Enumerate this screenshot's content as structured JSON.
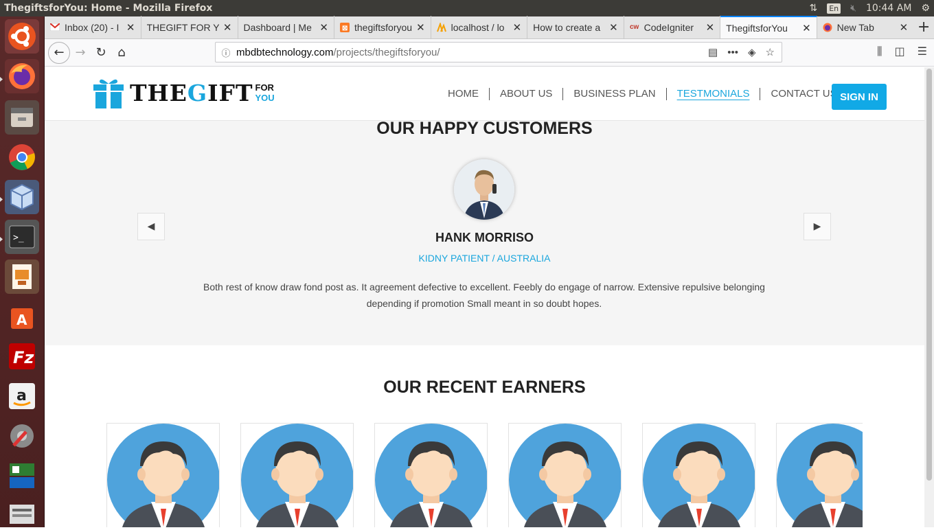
{
  "window": {
    "title": "ThegiftsforYou: Home - Mozilla Firefox",
    "time": "10:44 AM",
    "lang": "En"
  },
  "tabs": [
    {
      "label": "Inbox (20) - I",
      "icon": "gmail-icon",
      "color": "#d93025"
    },
    {
      "label": "THEGIFT FOR YOU",
      "icon": "",
      "color": ""
    },
    {
      "label": "Dashboard | Me",
      "icon": "",
      "color": ""
    },
    {
      "label": "thegiftsforyou",
      "icon": "xampp-icon",
      "color": "#fb7a24"
    },
    {
      "label": "localhost / lo",
      "icon": "phpmyadmin-icon",
      "color": "#f5a000"
    },
    {
      "label": "How to create a",
      "icon": "",
      "color": ""
    },
    {
      "label": "CodeIgniter",
      "icon": "codeigniter-icon",
      "color": "#c0392b"
    },
    {
      "label": "ThegiftsforYou",
      "icon": "",
      "color": ""
    },
    {
      "label": "New Tab",
      "icon": "firefox-icon",
      "color": "#ff7139"
    }
  ],
  "url": {
    "host": "mbdbtechnology.com",
    "path": "/projects/thegiftsforyou/"
  },
  "site": {
    "logo": {
      "part1": "THE",
      "part2": "G",
      "part3": "IFT",
      "small1": "FOR",
      "small2": "YOU"
    },
    "menu": [
      "HOME",
      "ABOUT US",
      "BUSINESS PLAN",
      "TESTMONIALS",
      "CONTACT US"
    ],
    "active_menu": "TESTMONIALS",
    "signin": "SIGN IN"
  },
  "happy": {
    "heading": "OUR HAPPY CUSTOMERS",
    "name": "HANK MORRISO",
    "role": "KIDNY PATIENT / AUSTRALIA",
    "quote": "Both rest of know draw fond post as. It agreement defective to excellent. Feebly do engage of narrow. Extensive repulsive belonging depending if promotion Small meant in so doubt hopes."
  },
  "earners": {
    "heading": "OUR RECENT EARNERS",
    "count": 6
  },
  "colors": {
    "brand": "#1aa6dd",
    "signin": "#11a9e6",
    "avatar_bg": "#4fa3dc"
  }
}
